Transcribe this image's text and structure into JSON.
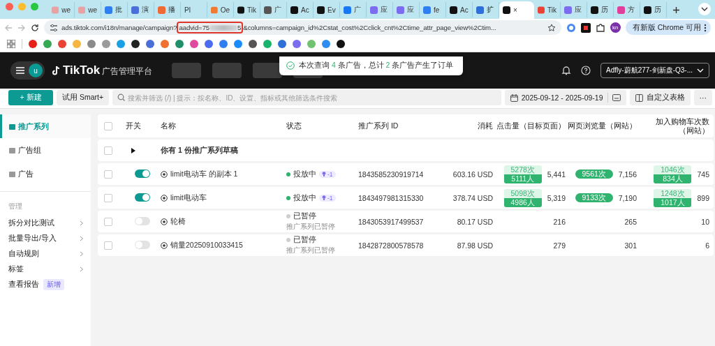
{
  "browser": {
    "tabs": [
      {
        "title": "we",
        "selected": false,
        "color": "#e7a3a3"
      },
      {
        "title": "we",
        "selected": false,
        "color": "#e7a3a3"
      },
      {
        "title": "批",
        "selected": false,
        "color": "#2f7ff0"
      },
      {
        "title": "演",
        "selected": false,
        "color": "#4a6fd8"
      },
      {
        "title": "播",
        "selected": false,
        "color": "#f06a35"
      },
      {
        "title": "Pl",
        "selected": false
      },
      {
        "title": "Oe",
        "selected": false,
        "color": "#f07a30"
      },
      {
        "title": "Tik",
        "selected": false,
        "color": "#111111"
      },
      {
        "title": "广",
        "selected": false,
        "color": "#555555"
      },
      {
        "title": "Ac",
        "selected": false,
        "color": "#111111"
      },
      {
        "title": "Ev",
        "selected": false,
        "color": "#111111"
      },
      {
        "title": "广",
        "selected": false,
        "color": "#1877f2"
      },
      {
        "title": "应",
        "selected": false,
        "color": "#7b6cf0"
      },
      {
        "title": "应",
        "selected": false,
        "color": "#7b6cf0"
      },
      {
        "title": "fe",
        "selected": false,
        "color": "#2f7ff0"
      },
      {
        "title": "Ac",
        "selected": false,
        "color": "#111111"
      },
      {
        "title": "扩",
        "selected": false,
        "color": "#2f6fd8"
      },
      {
        "title": "×",
        "selected": true,
        "color": "#111111"
      },
      {
        "title": "Tik",
        "selected": false,
        "color": "#ea4335"
      },
      {
        "title": "应",
        "selected": false,
        "color": "#7b6cf0"
      },
      {
        "title": "历",
        "selected": false,
        "color": "#111111"
      },
      {
        "title": "方",
        "selected": false,
        "color": "#e0409a"
      },
      {
        "title": "历",
        "selected": false,
        "color": "#111111"
      }
    ],
    "url": {
      "path": "ads.tiktok.com/i18n/manage/campaign?",
      "param": "aadvid=75",
      "param_end": "5",
      "rest": "&columns=campaign_id%2Cstat_cost%2Cclick_cnt%2Ctime_attr_page_view%2Ctim..."
    },
    "profile": "kn",
    "update_button": "有新版 Chrome 可用",
    "bookmarks": [
      {
        "color": "#e62117"
      },
      {
        "color": "#34a853"
      },
      {
        "color": "#ea4335"
      },
      {
        "color": "#f5b642"
      },
      {
        "color": "#8a8a8a"
      },
      {
        "color": "#9a9a9a"
      },
      {
        "color": "#1aa0e6"
      },
      {
        "color": "#222222"
      },
      {
        "color": "#4a6fd8"
      },
      {
        "color": "#f07030"
      },
      {
        "color": "#1f8f6a"
      },
      {
        "color": "#e04aa0"
      },
      {
        "color": "#4a6cf0"
      },
      {
        "color": "#2f7ff0"
      },
      {
        "color": "#1a8cff"
      },
      {
        "color": "#555555"
      },
      {
        "color": "#18b46b"
      },
      {
        "color": "#2f6fd8"
      },
      {
        "color": "#7b6cf0"
      },
      {
        "color": "#6fc36f"
      },
      {
        "color": "#2f8cf0"
      },
      {
        "color": "#111111"
      }
    ]
  },
  "header": {
    "avatar": "u",
    "logo": "TikTok",
    "product": "广告管理平台",
    "toast": [
      {
        "text": "本次查询 ",
        "highlight": false
      },
      {
        "text": "4",
        "highlight": true
      },
      {
        "text": " 条广告，总计 ",
        "highlight": false
      },
      {
        "text": "2",
        "highlight": true
      },
      {
        "text": " 条广告产生了订单",
        "highlight": false
      }
    ],
    "account": "Adfly-蔚航277-剑新盘-Q3-..."
  },
  "toolbar": {
    "new_button": "+ 新建",
    "smart_button": "试用 Smart+",
    "search": {
      "placeholder": "搜索并筛选 (/) | 提示：按名称、ID、设置、指标或其他筛选条件搜索"
    },
    "date_range": "2025-09-12 - 2025-09-19",
    "customize_button": "自定义表格",
    "more_button": "···"
  },
  "sidebar": {
    "items": [
      {
        "label": "推广系列",
        "selected": true
      },
      {
        "label": "广告组",
        "selected": false
      },
      {
        "label": "广告",
        "selected": false
      }
    ],
    "section": "管理",
    "links": [
      {
        "label": "拆分对比测试",
        "kind": "submenu"
      },
      {
        "label": "批量导出/导入",
        "kind": "submenu"
      },
      {
        "label": "自动规则",
        "kind": "submenu"
      },
      {
        "label": "标签",
        "kind": "submenu"
      },
      {
        "label": "查看报告",
        "kind": "badge",
        "badge": "新增"
      }
    ]
  },
  "table": {
    "header_checked": false,
    "columns": [
      "开关",
      "名称",
      "状态",
      "推广系列 ID",
      "消耗",
      "点击量（目标页面）",
      "网页浏览量（网站）",
      "加入购物车次数（网站）"
    ],
    "draft": {
      "text": "你有 1 份推广系列草稿",
      "checked": false,
      "expanded": false
    },
    "rows": [
      {
        "checked": false,
        "on": true,
        "name": "limit电动车 的副本 1",
        "status": {
          "label": "投放中",
          "active": true,
          "badge": "-1"
        },
        "id": "1843585230919714",
        "cost": "603.16 USD",
        "clicks": {
          "tags": [
            {
              "text": "5278次",
              "kind": "light"
            },
            {
              "text": "5111人",
              "kind": "solid"
            }
          ],
          "value": "5,441"
        },
        "views": {
          "tags": [
            {
              "text": "9561次",
              "kind": "pill"
            }
          ],
          "value": "7,156"
        },
        "cart": {
          "tags": [
            {
              "text": "1046次",
              "kind": "light"
            },
            {
              "text": "834人",
              "kind": "solid"
            }
          ],
          "value": "745"
        }
      },
      {
        "checked": false,
        "on": true,
        "name": "limit电动车",
        "status": {
          "label": "投放中",
          "active": true,
          "badge": "-1"
        },
        "id": "1843497981315330",
        "cost": "378.74 USD",
        "clicks": {
          "tags": [
            {
              "text": "5098次",
              "kind": "light"
            },
            {
              "text": "4986人",
              "kind": "solid"
            }
          ],
          "value": "5,319"
        },
        "views": {
          "tags": [
            {
              "text": "9133次",
              "kind": "pill"
            }
          ],
          "value": "7,190"
        },
        "cart": {
          "tags": [
            {
              "text": "1248次",
              "kind": "light"
            },
            {
              "text": "1017人",
              "kind": "solid"
            }
          ],
          "value": "899"
        }
      },
      {
        "checked": false,
        "on": false,
        "name": "轮椅",
        "status": {
          "label": "已暂停",
          "active": false,
          "note": "推广系列已暂停"
        },
        "id": "1843053917499537",
        "cost": "80.17 USD",
        "clicks": {
          "value": "216"
        },
        "views": {
          "value": "265"
        },
        "cart": {
          "value": "10"
        }
      },
      {
        "checked": false,
        "on": false,
        "name": "销量20250910033415",
        "status": {
          "label": "已暂停",
          "active": false,
          "note": "推广系列已暂停"
        },
        "id": "1842872800578578",
        "cost": "87.98 USD",
        "clicks": {
          "value": "279"
        },
        "views": {
          "value": "301"
        },
        "cart": {
          "value": "6"
        }
      }
    ]
  }
}
